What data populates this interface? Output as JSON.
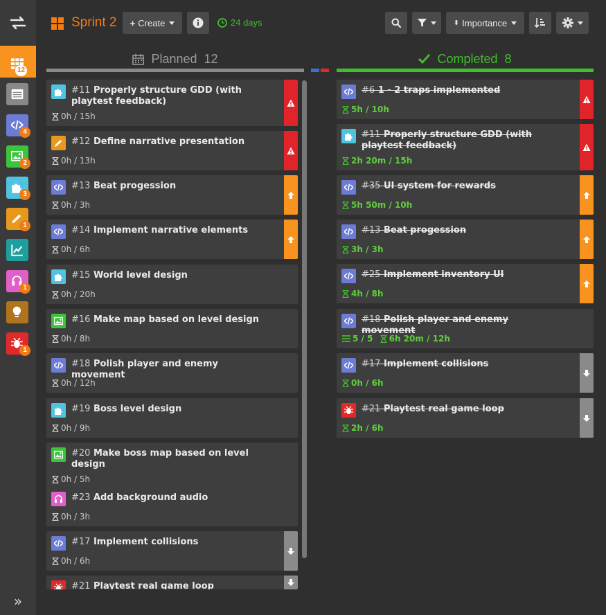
{
  "sidebar": {
    "swap_icon": "swap-icon",
    "items": [
      {
        "name": "board",
        "color": "#f7931e",
        "icon": "grid-icon",
        "badge": "12"
      },
      {
        "name": "backlog",
        "color": "#888888",
        "icon": "list-icon",
        "badge": ""
      },
      {
        "name": "code",
        "color": "#6c7bd4",
        "icon": "code-icon",
        "badge": "4"
      },
      {
        "name": "art",
        "color": "#3cc43c",
        "icon": "image-icon",
        "badge": "2"
      },
      {
        "name": "design",
        "color": "#4fc3e0",
        "icon": "puzzle-icon",
        "badge": "3"
      },
      {
        "name": "writing",
        "color": "#e8981c",
        "icon": "pencil-icon",
        "badge": "1"
      },
      {
        "name": "analytics",
        "color": "#1f9e9e",
        "icon": "chart-icon",
        "badge": ""
      },
      {
        "name": "audio",
        "color": "#e05fc9",
        "icon": "headphones-icon",
        "badge": "1"
      },
      {
        "name": "ideas",
        "color": "#b0751c",
        "icon": "bulb-icon",
        "badge": ""
      },
      {
        "name": "bugs",
        "color": "#e02a2a",
        "icon": "bug-icon",
        "badge": "1"
      }
    ],
    "expand": "»"
  },
  "header": {
    "sprint_title": "Sprint 2",
    "create_label": "Create",
    "days_label": "24 days",
    "sort_label": "Importance"
  },
  "columns": {
    "planned": {
      "label": "Planned",
      "count": "12"
    },
    "completed": {
      "label": "Completed",
      "count": "8"
    }
  },
  "planned_cards": [
    {
      "num": "#11",
      "title": "Properly structure GDD (with playtest feedback)",
      "meta": "0h / 15h",
      "type": "puzzle",
      "prio": "high"
    },
    {
      "num": "#12",
      "title": "Define narrative presentation",
      "meta": "0h / 13h",
      "type": "pencil",
      "prio": "high"
    },
    {
      "num": "#13",
      "title": "Beat progession",
      "meta": "0h / 3h",
      "type": "code",
      "prio": "up"
    },
    {
      "num": "#14",
      "title": "Implement narrative elements",
      "meta": "0h / 6h",
      "type": "code",
      "prio": "up"
    },
    {
      "num": "#15",
      "title": "World level design",
      "meta": "0h / 20h",
      "type": "puzzle",
      "prio": ""
    },
    {
      "num": "#16",
      "title": "Make map based on level design",
      "meta": "0h / 8h",
      "type": "image",
      "prio": ""
    },
    {
      "num": "#18",
      "title": "Polish player and enemy movement",
      "meta": "0h / 12h",
      "type": "code",
      "prio": ""
    },
    {
      "num": "#19",
      "title": "Boss level design",
      "meta": "0h / 9h",
      "type": "puzzle",
      "prio": ""
    },
    {
      "num": "#20",
      "title": "Make boss map based on level design",
      "meta": "0h / 5h",
      "type": "image",
      "prio": ""
    },
    {
      "num": "#23",
      "title": "Add background audio",
      "meta": "0h / 3h",
      "type": "audio",
      "prio": ""
    },
    {
      "num": "#17",
      "title": "Implement collisions",
      "meta": "0h / 6h",
      "type": "code",
      "prio": "down"
    },
    {
      "num": "#21",
      "title": "Playtest real game loop",
      "meta": "",
      "type": "bug",
      "prio": "down"
    }
  ],
  "completed_cards": [
    {
      "num": "#6",
      "title": "1 - 2 traps implemented",
      "meta": "5h / 10h",
      "type": "code",
      "prio": "high",
      "tasks": ""
    },
    {
      "num": "#11",
      "title": "Properly structure GDD (with playtest feedback)",
      "meta": "2h 20m / 15h",
      "type": "puzzle",
      "prio": "high",
      "tasks": ""
    },
    {
      "num": "#35",
      "title": "UI system for rewards",
      "meta": "5h 50m / 10h",
      "type": "code",
      "prio": "up",
      "tasks": ""
    },
    {
      "num": "#13",
      "title": "Beat progession",
      "meta": "3h / 3h",
      "type": "code",
      "prio": "up",
      "tasks": ""
    },
    {
      "num": "#25",
      "title": "Implement inventory UI",
      "meta": "4h / 8h",
      "type": "code",
      "prio": "up",
      "tasks": ""
    },
    {
      "num": "#18",
      "title": "Polish player and enemy movement",
      "meta": "6h 20m / 12h",
      "type": "code",
      "prio": "",
      "tasks": "5 / 5"
    },
    {
      "num": "#17",
      "title": "Implement collisions",
      "meta": "0h / 6h",
      "type": "code",
      "prio": "down",
      "tasks": ""
    },
    {
      "num": "#21",
      "title": "Playtest real game loop",
      "meta": "2h / 6h",
      "type": "bug",
      "prio": "down",
      "tasks": ""
    }
  ],
  "colors": {
    "accent": "#f07c16",
    "completed_green": "#3fbf2a",
    "prio_high": "#e0242a",
    "prio_up": "#f7931e",
    "prio_down": "#8a8a8a",
    "code": "#6c7bd4",
    "puzzle": "#4fc3e0",
    "pencil": "#e8981c",
    "image": "#3cc43c",
    "audio": "#e05fc9",
    "bug": "#e02a2a"
  }
}
